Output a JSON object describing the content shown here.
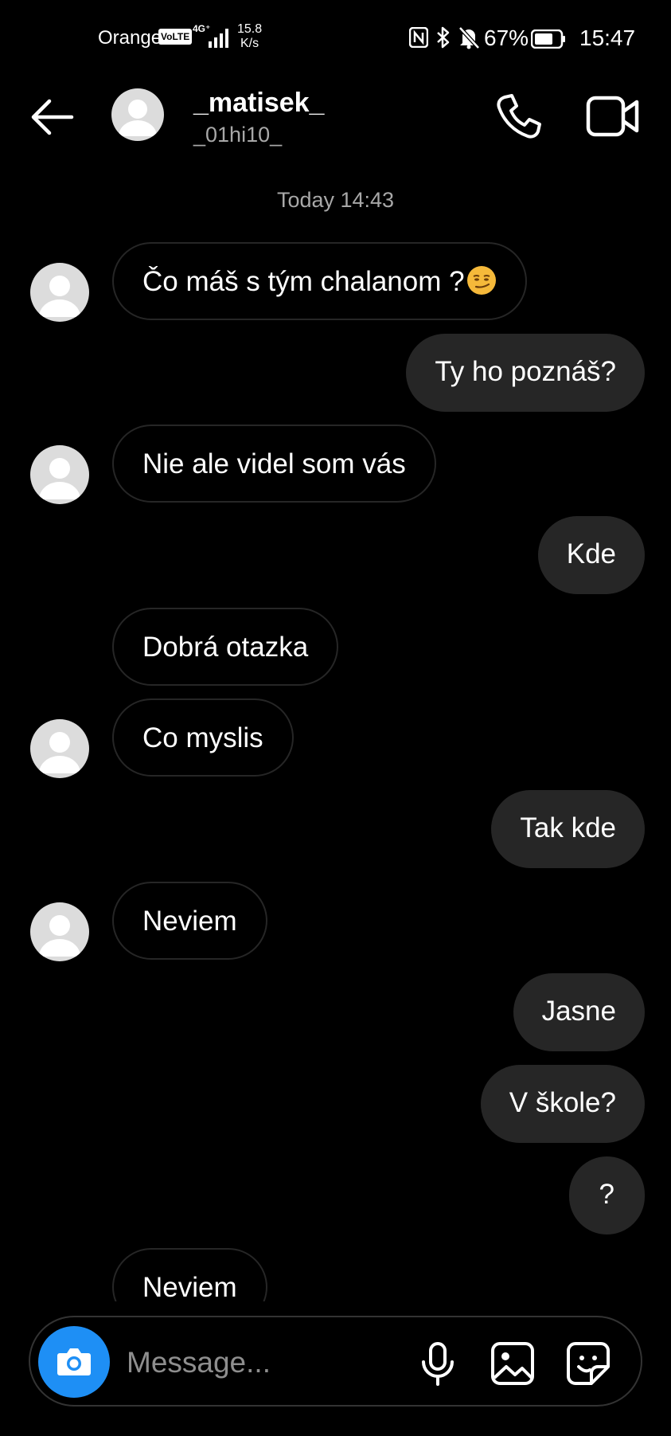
{
  "status_bar": {
    "carrier": "Orange",
    "volte": "VoLTE",
    "network": "4G⁺",
    "speed_value": "15.8",
    "speed_unit": "K/s",
    "battery": "67%",
    "time": "15:47"
  },
  "header": {
    "username": "_matisek_",
    "handle": "_01hi10_"
  },
  "timestamp": "Today 14:43",
  "messages": [
    {
      "side": "in",
      "text": "Čo máš s tým chalanom ?",
      "emoji": "smirking-face",
      "avatar": true
    },
    {
      "side": "out",
      "text": "Ty ho poznáš?"
    },
    {
      "side": "in",
      "text": "Nie ale videl som vás",
      "avatar": true
    },
    {
      "side": "out",
      "text": "Kde"
    },
    {
      "side": "in",
      "text": "Dobrá otazka",
      "avatar": false
    },
    {
      "side": "in",
      "text": "Co myslis",
      "avatar": true
    },
    {
      "side": "out",
      "text": "Tak kde"
    },
    {
      "side": "in",
      "text": "Neviem",
      "avatar": true
    },
    {
      "side": "out",
      "text": "Jasne"
    },
    {
      "side": "out",
      "text": "V škole?"
    },
    {
      "side": "out",
      "text": "?"
    },
    {
      "side": "in",
      "text": "Neviem",
      "avatar": false
    }
  ],
  "composer": {
    "placeholder": "Message..."
  },
  "colors": {
    "background": "#000000",
    "outgoing_bubble": "#262626",
    "incoming_border": "#262626",
    "camera_button": "#1e8ff5",
    "secondary_text": "#a8a8a8"
  },
  "icons": [
    "back-arrow-icon",
    "phone-icon",
    "video-camera-icon",
    "camera-icon",
    "microphone-icon",
    "gallery-icon",
    "sticker-icon"
  ]
}
